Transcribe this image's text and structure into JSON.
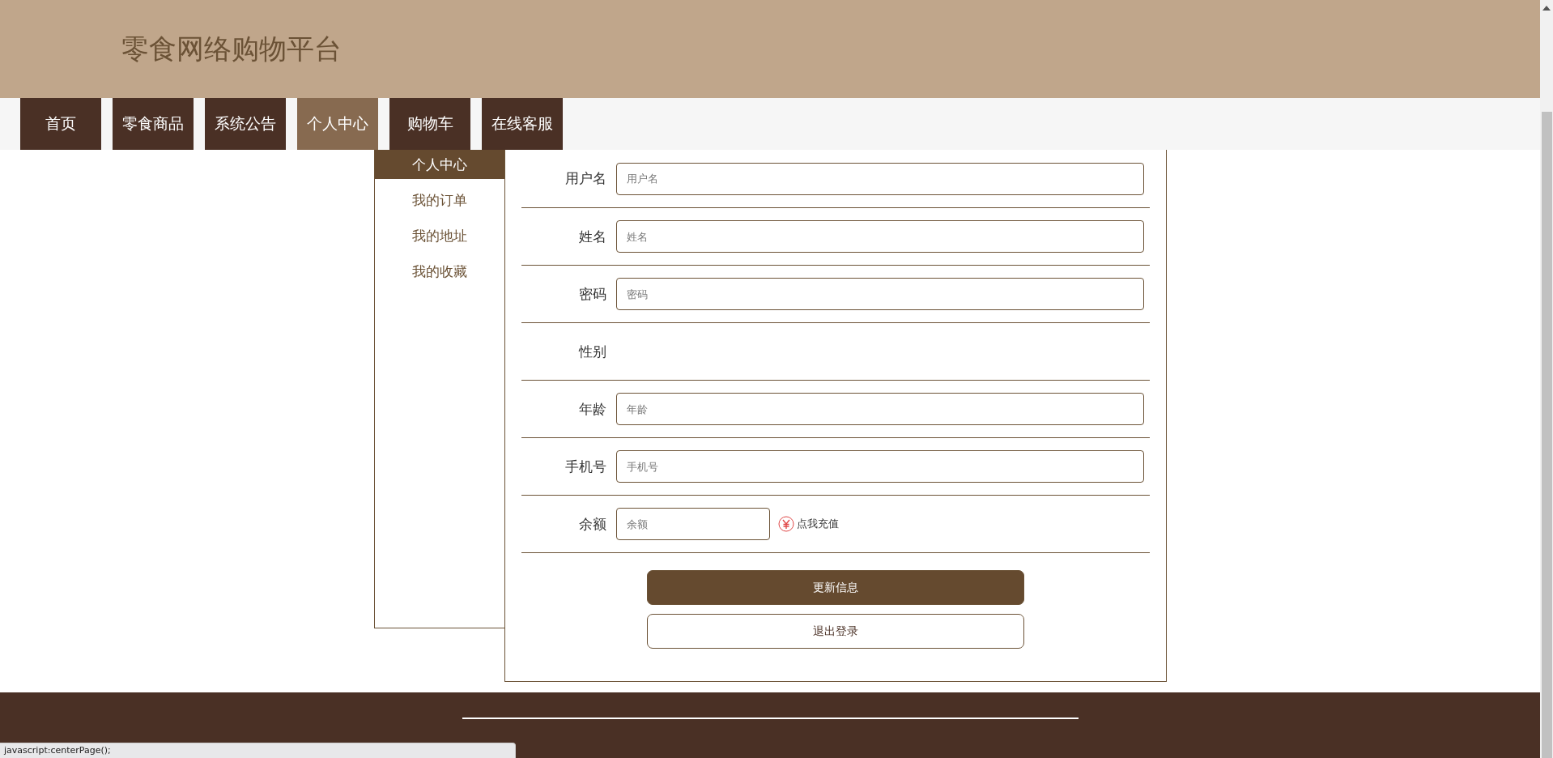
{
  "header": {
    "title": "零食网络购物平台"
  },
  "nav": [
    {
      "label": "首页",
      "selected": false
    },
    {
      "label": "零食商品",
      "selected": false
    },
    {
      "label": "系统公告",
      "selected": false
    },
    {
      "label": "个人中心",
      "selected": true
    },
    {
      "label": "购物车",
      "selected": false
    },
    {
      "label": "在线客服",
      "selected": false
    }
  ],
  "sidebar": {
    "items": [
      {
        "label": "个人中心",
        "selected": true
      },
      {
        "label": "我的订单",
        "selected": false
      },
      {
        "label": "我的地址",
        "selected": false
      },
      {
        "label": "我的收藏",
        "selected": false
      }
    ]
  },
  "form": {
    "fields": [
      {
        "kind": "text",
        "label": "用户名",
        "placeholder": "用户名"
      },
      {
        "kind": "text",
        "label": "姓名",
        "placeholder": "姓名"
      },
      {
        "kind": "text",
        "label": "密码",
        "placeholder": "密码"
      },
      {
        "kind": "blank",
        "label": "性别"
      },
      {
        "kind": "text",
        "label": "年龄",
        "placeholder": "年龄"
      },
      {
        "kind": "text",
        "label": "手机号",
        "placeholder": "手机号"
      },
      {
        "kind": "balance",
        "label": "余额",
        "placeholder": "余额",
        "link": "点我充值"
      }
    ],
    "buttons": [
      "更新信息",
      "退出登录"
    ]
  },
  "status_bar": "javascript:centerPage();"
}
